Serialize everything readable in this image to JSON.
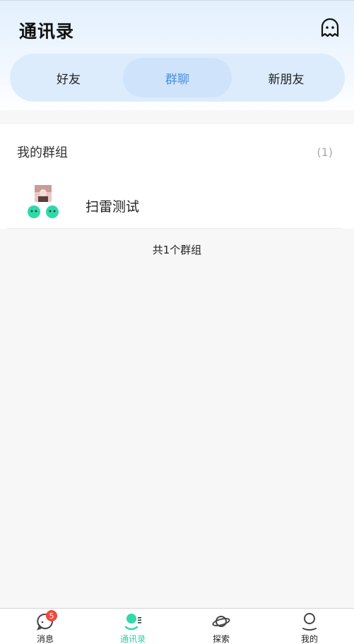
{
  "header": {
    "title": "通讯录",
    "ghost_icon": "ghost-icon"
  },
  "segments": [
    {
      "label": "好友",
      "active": false
    },
    {
      "label": "群聊",
      "active": true
    },
    {
      "label": "新朋友",
      "active": false
    }
  ],
  "groups_card": {
    "heading": "我的群组",
    "count": "(1)",
    "items": [
      {
        "name": "扫雷测试"
      }
    ]
  },
  "total_text": "共1个群组",
  "tabbar": {
    "items": [
      {
        "label": "消息",
        "icon": "message-bubble-icon",
        "badge": "5",
        "active": false
      },
      {
        "label": "通讯录",
        "icon": "contacts-icon",
        "active": true
      },
      {
        "label": "探索",
        "icon": "planet-icon",
        "active": false
      },
      {
        "label": "我的",
        "icon": "user-icon",
        "active": false
      }
    ]
  },
  "colors": {
    "accent": "#2fcfa8",
    "active_segment_text": "#4a8de0",
    "badge": "#f0483e"
  }
}
